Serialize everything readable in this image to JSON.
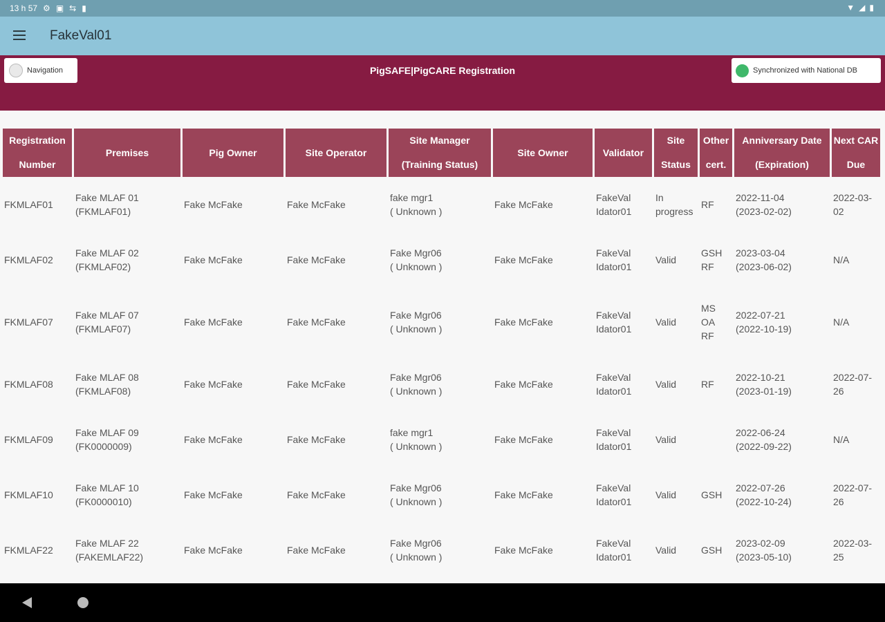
{
  "status_bar": {
    "time": "13 h 57",
    "icons": [
      "settings-icon",
      "notification-icon",
      "vpn-icon",
      "sd-card-icon",
      "wifi-icon",
      "signal-icon",
      "battery-icon"
    ]
  },
  "app_bar": {
    "title": "FakeVal01",
    "menu_icon": "menu-icon"
  },
  "banner": {
    "nav_label": "Navigation",
    "title": "PigSAFE|PigCARE Registration",
    "sync_label": "Synchronized with National DB",
    "sync_color": "#3fb86a",
    "background": "#861b42"
  },
  "table": {
    "header_color": "#9b4459",
    "headers": [
      [
        "Registration",
        "Number"
      ],
      [
        "Premises"
      ],
      [
        "Pig Owner"
      ],
      [
        "Site Operator"
      ],
      [
        "Site Manager",
        "(Training Status)"
      ],
      [
        "Site Owner"
      ],
      [
        "Validator"
      ],
      [
        "Site",
        "Status"
      ],
      [
        "Other",
        "cert."
      ],
      [
        "Anniversary Date",
        "(Expiration)"
      ],
      [
        "Next CAR",
        "Due"
      ]
    ],
    "rows": [
      [
        [
          "FKMLAF01"
        ],
        [
          "Fake MLAF 01",
          "(FKMLAF01)"
        ],
        [
          "Fake McFake"
        ],
        [
          "Fake McFake"
        ],
        [
          "fake mgr1",
          "( Unknown )"
        ],
        [
          "Fake McFake"
        ],
        [
          "FakeVal",
          "Idator01"
        ],
        [
          "In",
          "progress"
        ],
        [
          "RF"
        ],
        [
          "2022-11-04",
          "(2023-02-02)"
        ],
        [
          "2022-03-",
          "02"
        ]
      ],
      [
        [
          "FKMLAF02"
        ],
        [
          "Fake MLAF 02",
          "(FKMLAF02)"
        ],
        [
          "Fake McFake"
        ],
        [
          "Fake McFake"
        ],
        [
          "Fake Mgr06",
          "( Unknown )"
        ],
        [
          "Fake McFake"
        ],
        [
          "FakeVal",
          "Idator01"
        ],
        [
          "Valid"
        ],
        [
          "GSH",
          "RF"
        ],
        [
          "2023-03-04",
          "(2023-06-02)"
        ],
        [
          "N/A"
        ]
      ],
      [
        [
          "FKMLAF07"
        ],
        [
          "Fake MLAF 07",
          "(FKMLAF07)"
        ],
        [
          "Fake McFake"
        ],
        [
          "Fake McFake"
        ],
        [
          "Fake Mgr06",
          "( Unknown )"
        ],
        [
          "Fake McFake"
        ],
        [
          "FakeVal",
          "Idator01"
        ],
        [
          "Valid"
        ],
        [
          "MS",
          "OA",
          "RF"
        ],
        [
          "2022-07-21",
          "(2022-10-19)"
        ],
        [
          "N/A"
        ]
      ],
      [
        [
          "FKMLAF08"
        ],
        [
          "Fake MLAF 08",
          "(FKMLAF08)"
        ],
        [
          "Fake McFake"
        ],
        [
          "Fake McFake"
        ],
        [
          "Fake Mgr06",
          "( Unknown )"
        ],
        [
          "Fake McFake"
        ],
        [
          "FakeVal",
          "Idator01"
        ],
        [
          "Valid"
        ],
        [
          "RF"
        ],
        [
          "2022-10-21",
          "(2023-01-19)"
        ],
        [
          "2022-07-",
          "26"
        ]
      ],
      [
        [
          "FKMLAF09"
        ],
        [
          "Fake MLAF 09",
          "(FK0000009)"
        ],
        [
          "Fake McFake"
        ],
        [
          "Fake McFake"
        ],
        [
          "fake mgr1",
          "( Unknown )"
        ],
        [
          "Fake McFake"
        ],
        [
          "FakeVal",
          "Idator01"
        ],
        [
          "Valid"
        ],
        [
          ""
        ],
        [
          "2022-06-24",
          "(2022-09-22)"
        ],
        [
          "N/A"
        ]
      ],
      [
        [
          "FKMLAF10"
        ],
        [
          "Fake MLAF 10",
          "(FK0000010)"
        ],
        [
          "Fake McFake"
        ],
        [
          "Fake McFake"
        ],
        [
          "Fake Mgr06",
          "( Unknown )"
        ],
        [
          "Fake McFake"
        ],
        [
          "FakeVal",
          "Idator01"
        ],
        [
          "Valid"
        ],
        [
          "GSH"
        ],
        [
          "2022-07-26",
          "(2022-10-24)"
        ],
        [
          "2022-07-",
          "26"
        ]
      ],
      [
        [
          "FKMLAF22"
        ],
        [
          "Fake MLAF 22",
          "(FAKEMLAF22)"
        ],
        [
          "Fake McFake"
        ],
        [
          "Fake McFake"
        ],
        [
          "Fake Mgr06",
          "( Unknown )"
        ],
        [
          "Fake McFake"
        ],
        [
          "FakeVal",
          "Idator01"
        ],
        [
          "Valid"
        ],
        [
          "GSH"
        ],
        [
          "2023-02-09",
          "(2023-05-10)"
        ],
        [
          "2022-03-",
          "25"
        ]
      ]
    ]
  },
  "system_nav": {
    "back_icon": "back-icon",
    "home_icon": "home-icon"
  }
}
